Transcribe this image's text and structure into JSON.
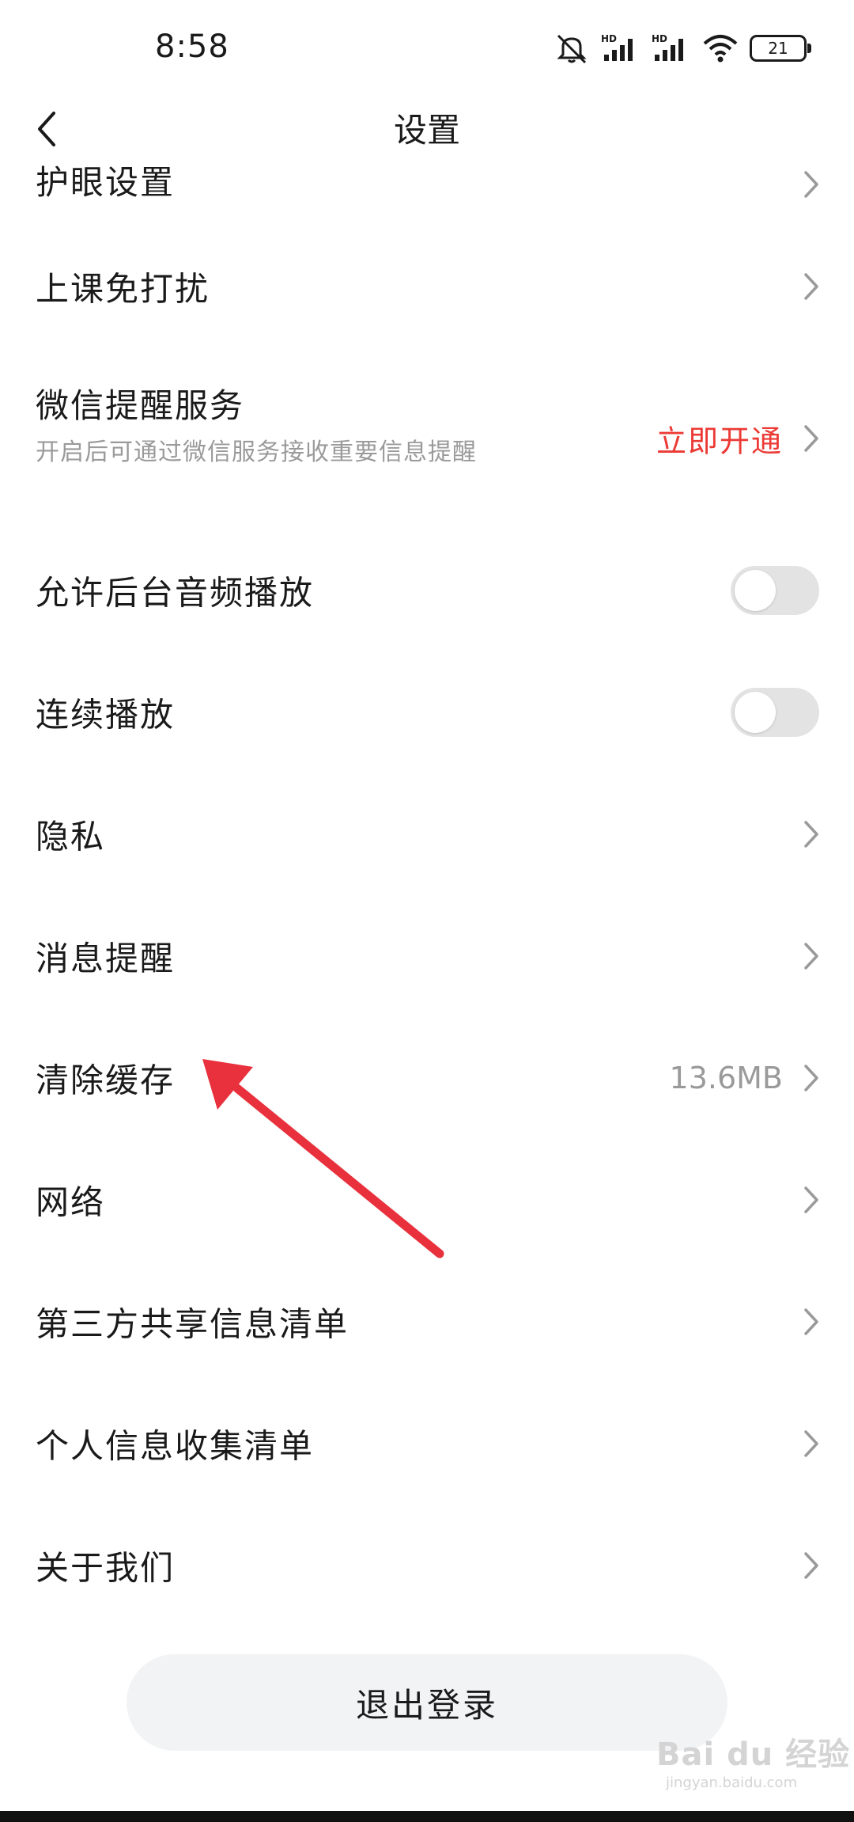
{
  "status_bar": {
    "time": "8:58",
    "battery": "21",
    "icons": [
      "mute-icon",
      "hd-signal-icon",
      "hd-signal-icon",
      "wifi-icon",
      "battery-icon"
    ]
  },
  "nav": {
    "title": "设置",
    "back_icon": "chevron-left-icon"
  },
  "settings": {
    "eye_care": "护眼设置",
    "class_dnd": "上课免打扰",
    "wechat_reminder": "微信提醒服务",
    "wechat_reminder_desc": "开启后可通过微信服务接收重要信息提醒",
    "wechat_reminder_action": "立即开通",
    "background_audio": "允许后台音频播放",
    "background_audio_on": false,
    "continuous_play": "连续播放",
    "continuous_play_on": false,
    "privacy": "隐私",
    "message_reminder": "消息提醒",
    "clear_cache": "清除缓存",
    "cache_size": "13.6MB",
    "network": "网络",
    "third_party_list": "第三方共享信息清单",
    "personal_info_list": "个人信息收集清单",
    "about_us": "关于我们"
  },
  "logout_label": "退出登录",
  "watermark": {
    "text": "Bai du 经验",
    "url": "jingyan.baidu.com"
  },
  "colors": {
    "accent_red": "#ec3a35",
    "annotation_arrow": "#e8313c",
    "secondary_text": "#9a9a9a",
    "toggle_off": "#e3e3e3"
  }
}
